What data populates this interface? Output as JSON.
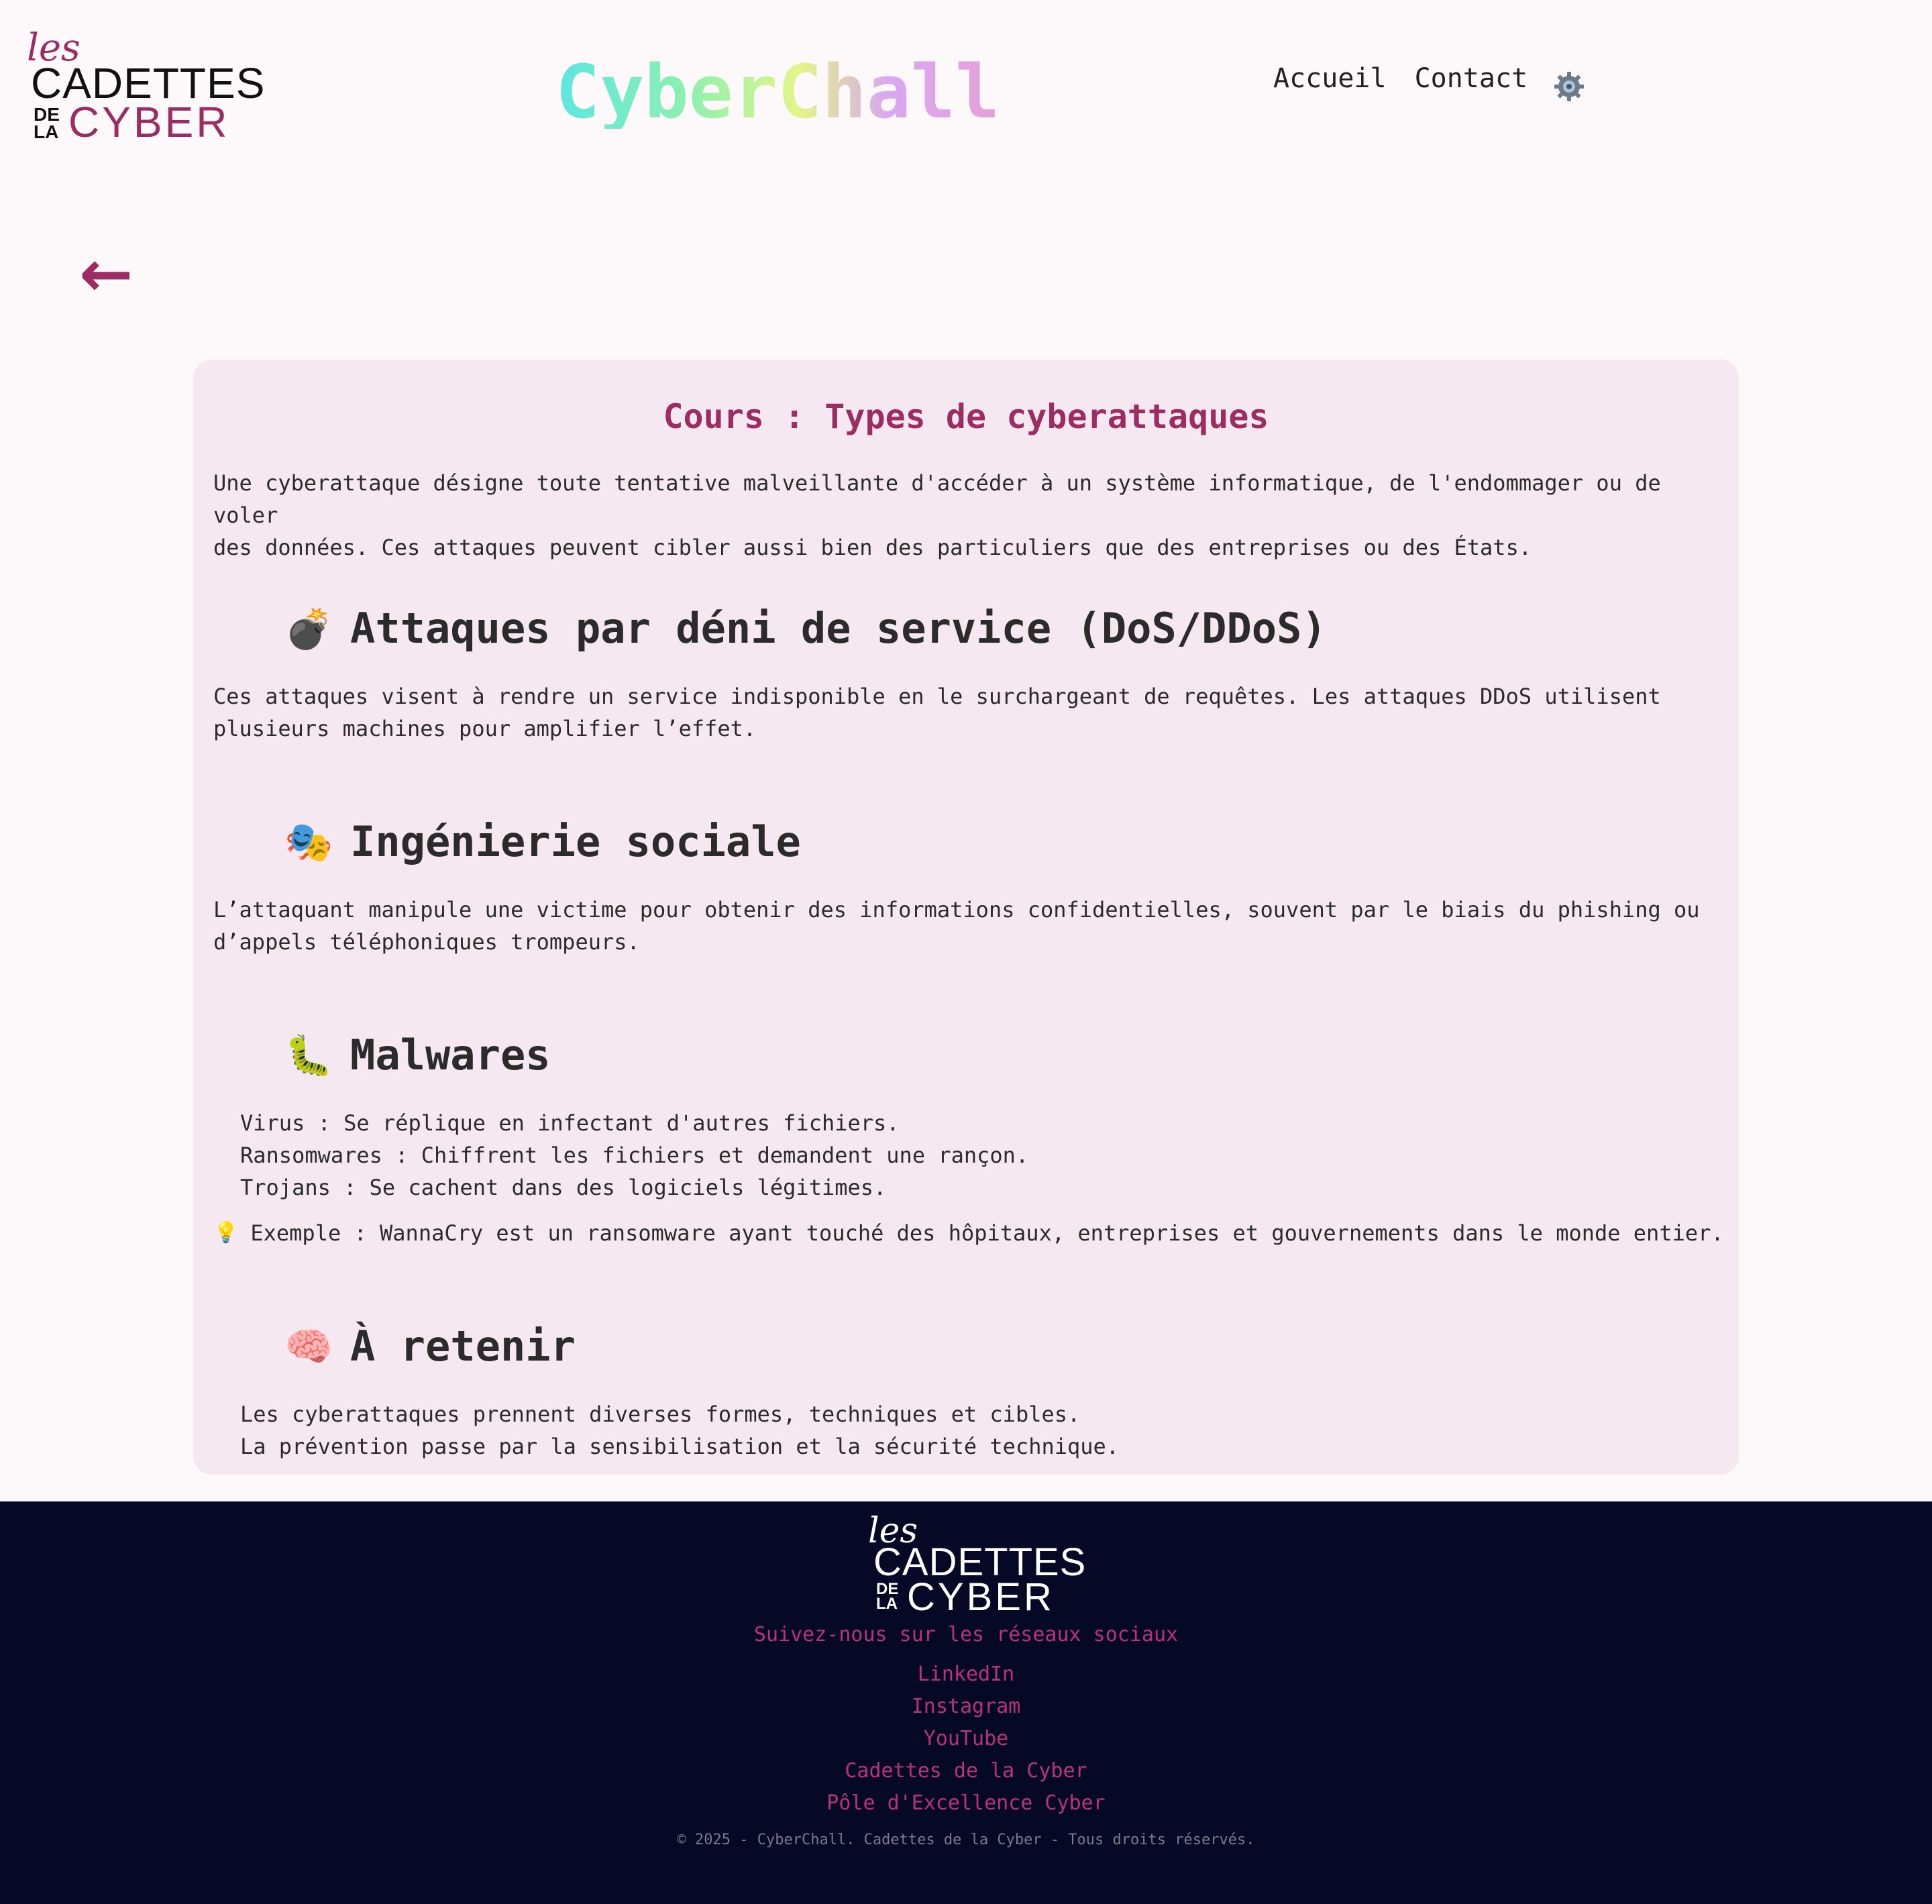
{
  "header": {
    "logo": {
      "les": "les",
      "cadettes": "CADETTES",
      "de": "DE",
      "la": "LA",
      "cyber": "CYBER"
    },
    "title": "CyberChall",
    "nav": [
      {
        "label": "Accueil"
      },
      {
        "label": "Contact"
      }
    ],
    "settings_icon": "gear-icon"
  },
  "back": {
    "label": "←",
    "icon": "back-arrow-icon"
  },
  "course": {
    "title": "Cours : Types de cyberattaques",
    "intro_line1": "Une cyberattaque désigne toute tentative malveillante d'accéder à un système informatique, de l'endommager ou de voler",
    "intro_line2": "des données. Ces attaques peuvent cibler aussi bien des particuliers que des entreprises ou des États.",
    "sections": [
      {
        "emoji": "💣",
        "heading": "Attaques par déni de service (DoS/DDoS)",
        "line1": "Ces attaques visent à rendre un service indisponible en le surchargeant de requêtes. Les attaques DDoS utilisent",
        "line2": "plusieurs machines pour amplifier l’effet."
      },
      {
        "emoji": "🎭",
        "heading": "Ingénierie sociale",
        "line1": "L’attaquant manipule une victime pour obtenir des informations confidentielles, souvent par le biais du phishing ou",
        "line2": "d’appels téléphoniques trompeurs."
      },
      {
        "emoji": "🐛",
        "heading": "Malwares",
        "items": [
          "Virus : Se réplique en infectant d'autres fichiers.",
          "Ransomwares : Chiffrent les fichiers et demandent une rançon.",
          "Trojans : Se cachent dans des logiciels légitimes."
        ],
        "tip_icon": "💡",
        "tip": "Exemple : WannaCry est un ransomware ayant touché des hôpitaux, entreprises et gouvernements dans le monde entier."
      },
      {
        "emoji": "🧠",
        "heading": "À retenir",
        "items": [
          "Les cyberattaques prennent diverses formes, techniques et cibles.",
          "La prévention passe par la sensibilisation et la sécurité technique."
        ]
      }
    ]
  },
  "footer": {
    "logo": {
      "les": "les",
      "cadettes": "CADETTES",
      "de": "DE",
      "la": "LA",
      "cyber": "CYBER"
    },
    "follow": "Suivez-nous sur les réseaux sociaux",
    "links": [
      "LinkedIn",
      "Instagram",
      "YouTube",
      "Cadettes de la Cyber",
      "Pôle d'Excellence Cyber"
    ],
    "copyright": "© 2025 - CyberChall. Cadettes de la Cyber - Tous droits réservés."
  },
  "colors": {
    "accent": "#9b2d63",
    "footer_bg": "#060926",
    "footer_link": "#b8337a",
    "card_bg": "#f6e8f0",
    "page_bg": "#fdf9fb"
  }
}
